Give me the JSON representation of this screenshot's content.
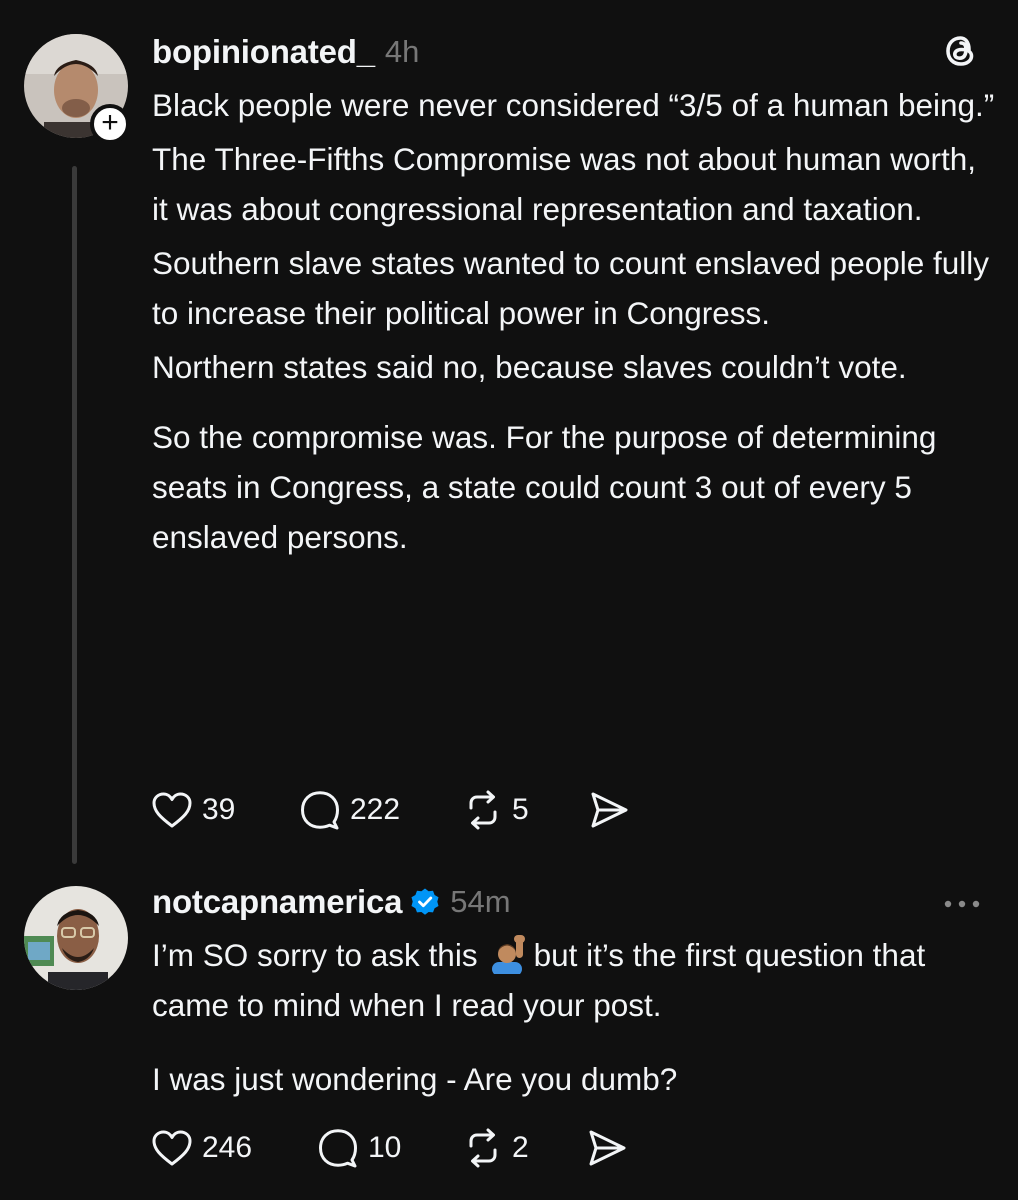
{
  "posts": [
    {
      "username": "bopinionated_",
      "time": "4h",
      "follow_badge": "+",
      "corner_icon": "threads-logo-icon",
      "paragraphs": [
        "Black people were never considered “3/5 of a human being.”",
        "The Three-Fifths Compromise was not about human worth, it was about congressional representation and taxation.",
        "Southern slave states wanted to count enslaved people fully to increase their political power in Congress.",
        "Northern states said no, because slaves couldn’t vote.",
        "So the compromise was. For the purpose of determining seats in Congress, a state could count 3 out of every 5 enslaved persons."
      ],
      "counts": {
        "likes": "39",
        "replies": "222",
        "reposts": "5"
      }
    },
    {
      "username": "notcapnamerica",
      "verified": true,
      "time": "54m",
      "corner_icon": "more-options-icon",
      "line1_before_emoji": "I’m SO sorry to ask this",
      "emoji": "person-raising-hand-emoji",
      "line1_after_emoji": "but it’s the first question that came to mind when I read your post.",
      "paragraph2": "I was just wondering - Are you dumb?",
      "counts": {
        "likes": "246",
        "replies": "10",
        "reposts": "2"
      }
    }
  ],
  "colors": {
    "background": "#101010",
    "text": "#f3f5f7",
    "secondary": "#777777",
    "verified": "#0095f6",
    "thread_line": "#3a3a3a"
  }
}
